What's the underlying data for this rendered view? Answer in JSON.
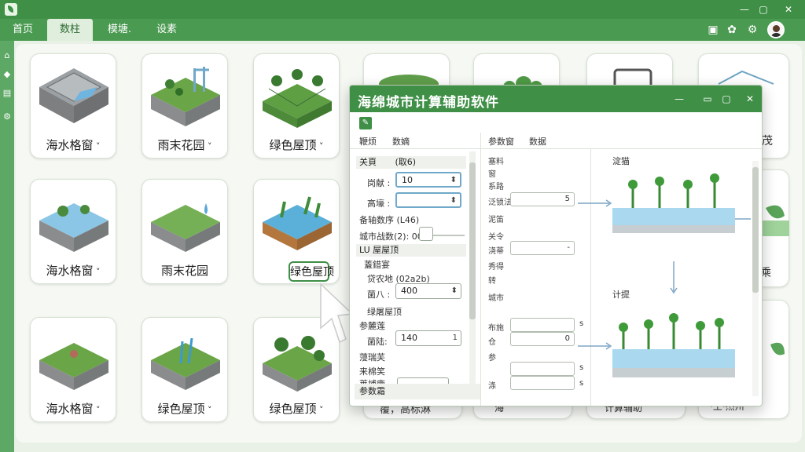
{
  "nav": {
    "tabs": [
      "首页",
      "数柱",
      "模塘.",
      "设素"
    ]
  },
  "cards": [
    {
      "label": "海水格窗",
      "dropdown": true
    },
    {
      "label": "雨末花园",
      "dropdown": true
    },
    {
      "label": "绿色屋顶",
      "dropdown": true
    },
    {
      "label": "海水格窗",
      "dropdown": true
    },
    {
      "label": "雨末花园",
      "dropdown": false
    },
    {
      "label": "绿色屋顶",
      "dropdown": false
    },
    {
      "label": "海水格窗",
      "dropdown": true
    },
    {
      "label": "绿色屋顶",
      "dropdown": true
    },
    {
      "label": "绿色屋顶",
      "dropdown": true
    }
  ],
  "background_card_labels": [
    "茂",
    "乘",
    "覆，高标淋",
    "海",
    "计算辅助",
    "·工·杰州"
  ],
  "dialog": {
    "title": "海绵城市计算辅助软件",
    "menu_left": [
      "鞭烦",
      "数嫡"
    ],
    "menu_right": [
      "参数窗",
      "数据"
    ],
    "left_panel": {
      "section1": {
        "head": "关頁",
        "head_value": "(取6)"
      },
      "field1": {
        "label": "岗献 :",
        "value": "10"
      },
      "field2": {
        "label": "高壕 :",
        "value": ""
      },
      "slider_group": {
        "label": "备轴数序 (L46)",
        "sub_label": "城市战数(2): 000"
      },
      "section2": {
        "head": "LU 屋屋顶"
      },
      "sub_item": "蓋錯宴",
      "field3_caption": "贷农地 (02a2b)",
      "field3": {
        "label": "菌八 :",
        "value": "400"
      },
      "sub_item2": "绿屠屋顶",
      "sub_item3": "参麓莲",
      "field4": {
        "label": "菌陆:",
        "value": "140"
      },
      "field4_spin": "1",
      "sub_item4": "蓡瑞芙",
      "sub_item5": "来棉笑",
      "sub_item6": "莱埔鹿",
      "footer": "参数霜"
    },
    "mid_panel": {
      "labels": [
        "塞料",
        "窗",
        "系路",
        "泛锁法",
        "泥笛",
        "关令",
        "浇蒂",
        "秀得",
        "转",
        "城市",
        "布施",
        "仓",
        "参",
        "涤"
      ],
      "inputs": [
        "",
        "",
        ""
      ],
      "field_values": [
        "5",
        "-",
        "",
        "0",
        "",
        ""
      ],
      "units": [
        "s",
        "s",
        "s"
      ]
    },
    "diagram": {
      "top_label": "淀猫",
      "bottom_label": "计提"
    }
  },
  "colors": {
    "primary": "#3f8f47",
    "nav": "#4a9a51",
    "background": "#e9f1e6"
  },
  "icons": [
    "app-logo-icon",
    "gear-icon",
    "settings-icon",
    "screenshot-icon",
    "minimize-icon",
    "maximize-icon",
    "close-icon"
  ]
}
